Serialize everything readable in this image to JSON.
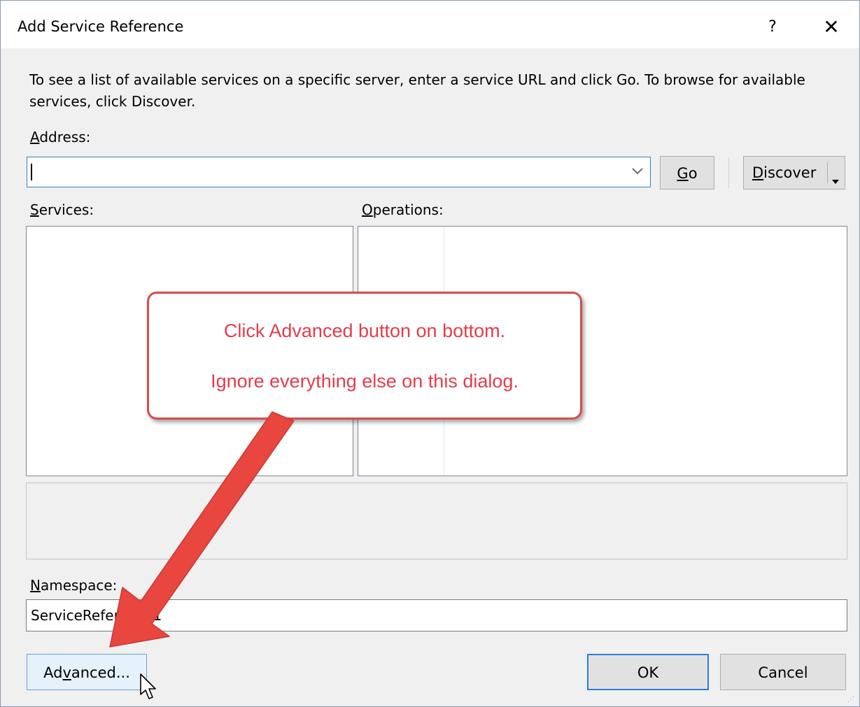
{
  "window": {
    "title": "Add Service Reference",
    "help_label": "?",
    "close_label": "✕"
  },
  "description": "To see a list of available services on a specific server, enter a service URL and click Go. To browse for available services, click Discover.",
  "address": {
    "label_key": "A",
    "label_rest": "ddress:",
    "value": ""
  },
  "go": {
    "key": "G",
    "rest": "o"
  },
  "discover": {
    "key": "D",
    "rest": "iscover"
  },
  "services": {
    "label_key": "S",
    "label_rest": "ervices:"
  },
  "operations": {
    "label_key": "O",
    "label_rest": "perations:"
  },
  "namespace": {
    "label_key": "N",
    "label_rest": "amespace:",
    "value": "ServiceReference1"
  },
  "buttons": {
    "advanced_pre": "Ad",
    "advanced_key": "v",
    "advanced_post": "anced...",
    "ok": "OK",
    "cancel": "Cancel"
  },
  "callout": {
    "line1": "Click Advanced button on bottom.",
    "line2": "Ignore everything else on this dialog."
  },
  "colors": {
    "callout_text": "#e23d4b",
    "callout_border": "#d84c4c",
    "arrow": "#e8463f",
    "focus_border": "#3c7fb1"
  }
}
